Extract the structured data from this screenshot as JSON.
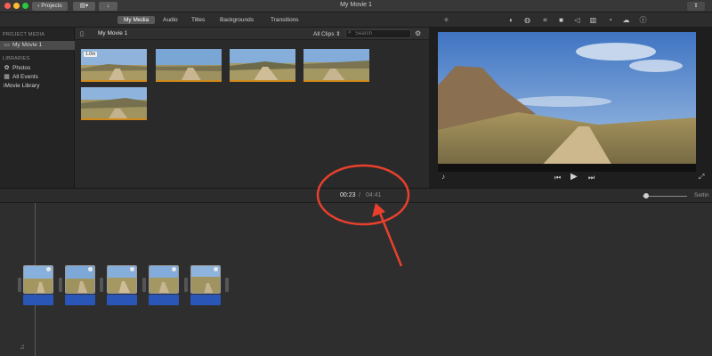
{
  "window": {
    "title": "My Movie 1",
    "projects_label": "Projects",
    "colors": {
      "accent": "#d08a1c",
      "audio": "#2a56b8",
      "annotation": "#e8402d"
    }
  },
  "tabs": [
    "My Media",
    "Audio",
    "Titles",
    "Backgrounds",
    "Transitions"
  ],
  "active_tab": "My Media",
  "sidebar": {
    "project_media_header": "PROJECT MEDIA",
    "project_item": "My Movie 1",
    "libraries_header": "LIBRARIES",
    "library_items": [
      "Photos",
      "All Events",
      "iMovie Library"
    ]
  },
  "browser": {
    "title": "My Movie 1",
    "filter_label": "All Clips",
    "search_placeholder": "Search",
    "first_clip_duration": "1.0m"
  },
  "viewer": {
    "icons": [
      "magic-wand-icon",
      "color-balance-icon",
      "color-correction-icon",
      "crop-icon",
      "stabilization-icon",
      "volume-icon",
      "noise-reduction-icon",
      "speed-icon",
      "filter-icon",
      "info-icon"
    ]
  },
  "timeline": {
    "current_time": "00:23",
    "separator": "/",
    "total_time": "04:41",
    "settings_label": "Settin"
  }
}
